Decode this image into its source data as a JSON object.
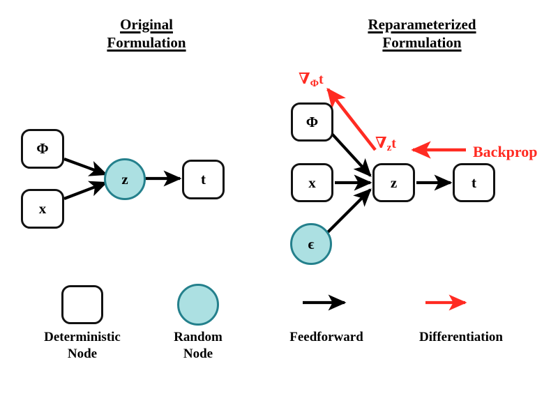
{
  "diagram": {
    "title_left_lines": [
      "Original",
      "Formulation"
    ],
    "title_right_lines": [
      "Reparameterized",
      "Formulation"
    ],
    "colors": {
      "node_stroke": "#121212",
      "random_fill": "#ace0e2",
      "random_stroke": "#24808c",
      "feedforward_arrow": "#000000",
      "differentiation_arrow": "#ff2b22"
    }
  },
  "left_panel": {
    "nodes": [
      {
        "id": "phi",
        "label": "Φ",
        "type": "deterministic"
      },
      {
        "id": "x",
        "label": "x",
        "type": "deterministic"
      },
      {
        "id": "z",
        "label": "z",
        "type": "random"
      },
      {
        "id": "t",
        "label": "t",
        "type": "deterministic"
      }
    ],
    "edges": [
      {
        "from": "phi",
        "to": "z",
        "kind": "feedforward"
      },
      {
        "from": "x",
        "to": "z",
        "kind": "feedforward"
      },
      {
        "from": "z",
        "to": "t",
        "kind": "feedforward"
      }
    ]
  },
  "right_panel": {
    "nodes": [
      {
        "id": "phi",
        "label": "Φ",
        "type": "deterministic"
      },
      {
        "id": "x",
        "label": "x",
        "type": "deterministic"
      },
      {
        "id": "epsilon",
        "label": "ϵ",
        "type": "random"
      },
      {
        "id": "z",
        "label": "z",
        "type": "deterministic"
      },
      {
        "id": "t",
        "label": "t",
        "type": "deterministic"
      }
    ],
    "edges": [
      {
        "from": "phi",
        "to": "z",
        "kind": "feedforward"
      },
      {
        "from": "x",
        "to": "z",
        "kind": "feedforward"
      },
      {
        "from": "epsilon",
        "to": "z",
        "kind": "feedforward"
      },
      {
        "from": "z",
        "to": "t",
        "kind": "feedforward"
      }
    ],
    "gradient_labels": [
      {
        "id": "grad-phi",
        "nabla": "∇",
        "subscript": "Φ",
        "target": "t"
      },
      {
        "id": "grad-z",
        "nabla": "∇",
        "subscript": "z",
        "target": "t"
      }
    ],
    "backprop_label": "Backprop"
  },
  "legend": {
    "items": [
      {
        "id": "deterministic-node",
        "glyph": "rounded-square",
        "caption_lines": [
          "Deterministic",
          "Node"
        ]
      },
      {
        "id": "random-node",
        "glyph": "circle",
        "caption_lines": [
          "Random",
          "Node"
        ]
      },
      {
        "id": "feedforward",
        "glyph": "black-arrow",
        "caption_lines": [
          "Feedforward"
        ]
      },
      {
        "id": "differentiation",
        "glyph": "red-arrow",
        "caption_lines": [
          "Differentiation"
        ]
      }
    ]
  }
}
